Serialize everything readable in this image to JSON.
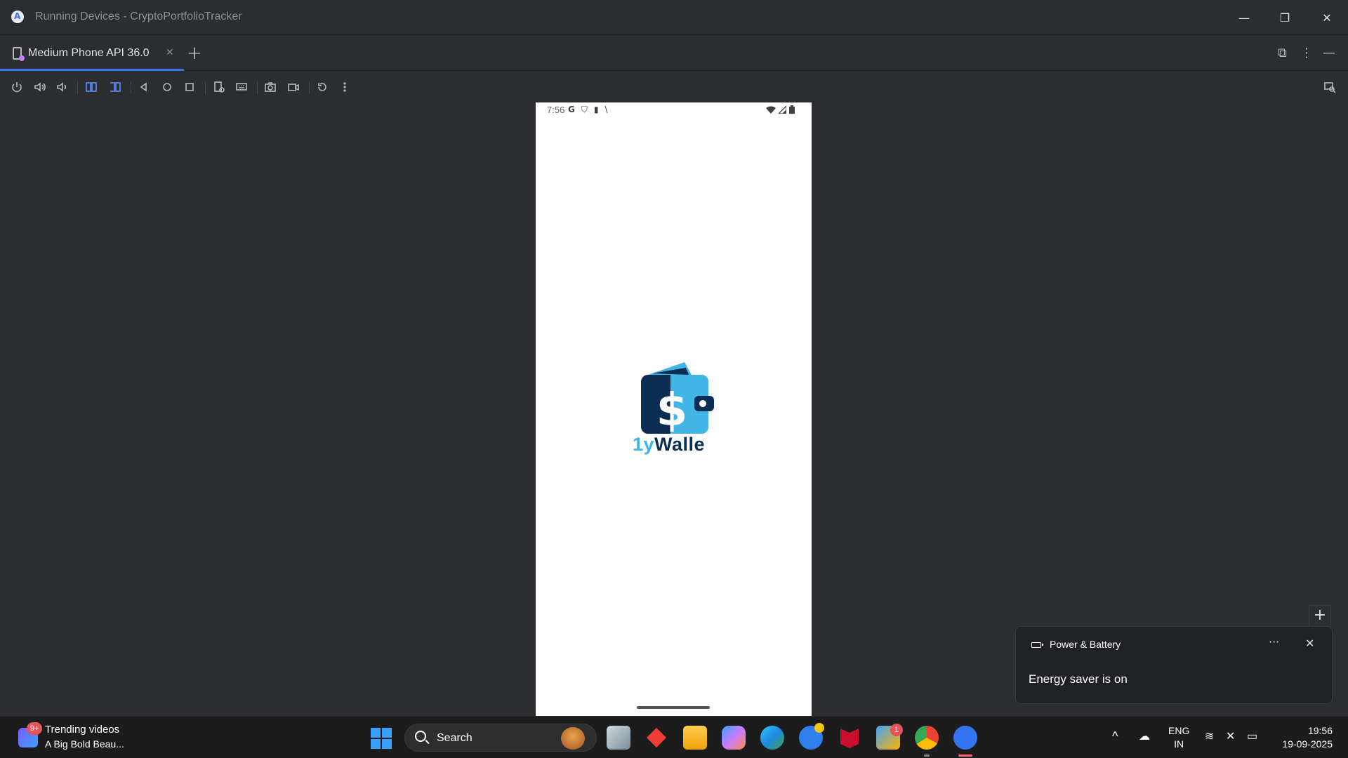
{
  "window": {
    "title": "Running Devices - CryptoPortfolioTracker"
  },
  "tabs": [
    {
      "label": "Medium Phone API 36.0",
      "active": true
    }
  ],
  "toolbar": {
    "icons": [
      "power-icon",
      "volume-up-icon",
      "volume-down-icon",
      "rotate-left-icon",
      "rotate-right-icon",
      "back-icon",
      "home-icon",
      "overview-icon",
      "device-settings-icon",
      "keyboard-icon",
      "screenshot-icon",
      "screen-record-icon",
      "reset-icon",
      "more-icon"
    ]
  },
  "device": {
    "status_time": "7:56",
    "app_name_partial_left": "1y",
    "app_name_partial_right": "Walle"
  },
  "notification": {
    "source": "Power & Battery",
    "body": "Energy saver is on"
  },
  "taskbar": {
    "widget_badge": "9+",
    "widget_title": "Trending videos",
    "widget_subtitle": "A Big Bold Beau...",
    "search_label": "Search",
    "store_badge": "1",
    "lang_top": "ENG",
    "lang_bottom": "IN",
    "time": "19:56",
    "date": "19-09-2025"
  },
  "colors": {
    "accent": "#3574f0",
    "ide_background": "#2b2d30",
    "logo_dark": "#0c2d52",
    "logo_light": "#41b6e6"
  }
}
